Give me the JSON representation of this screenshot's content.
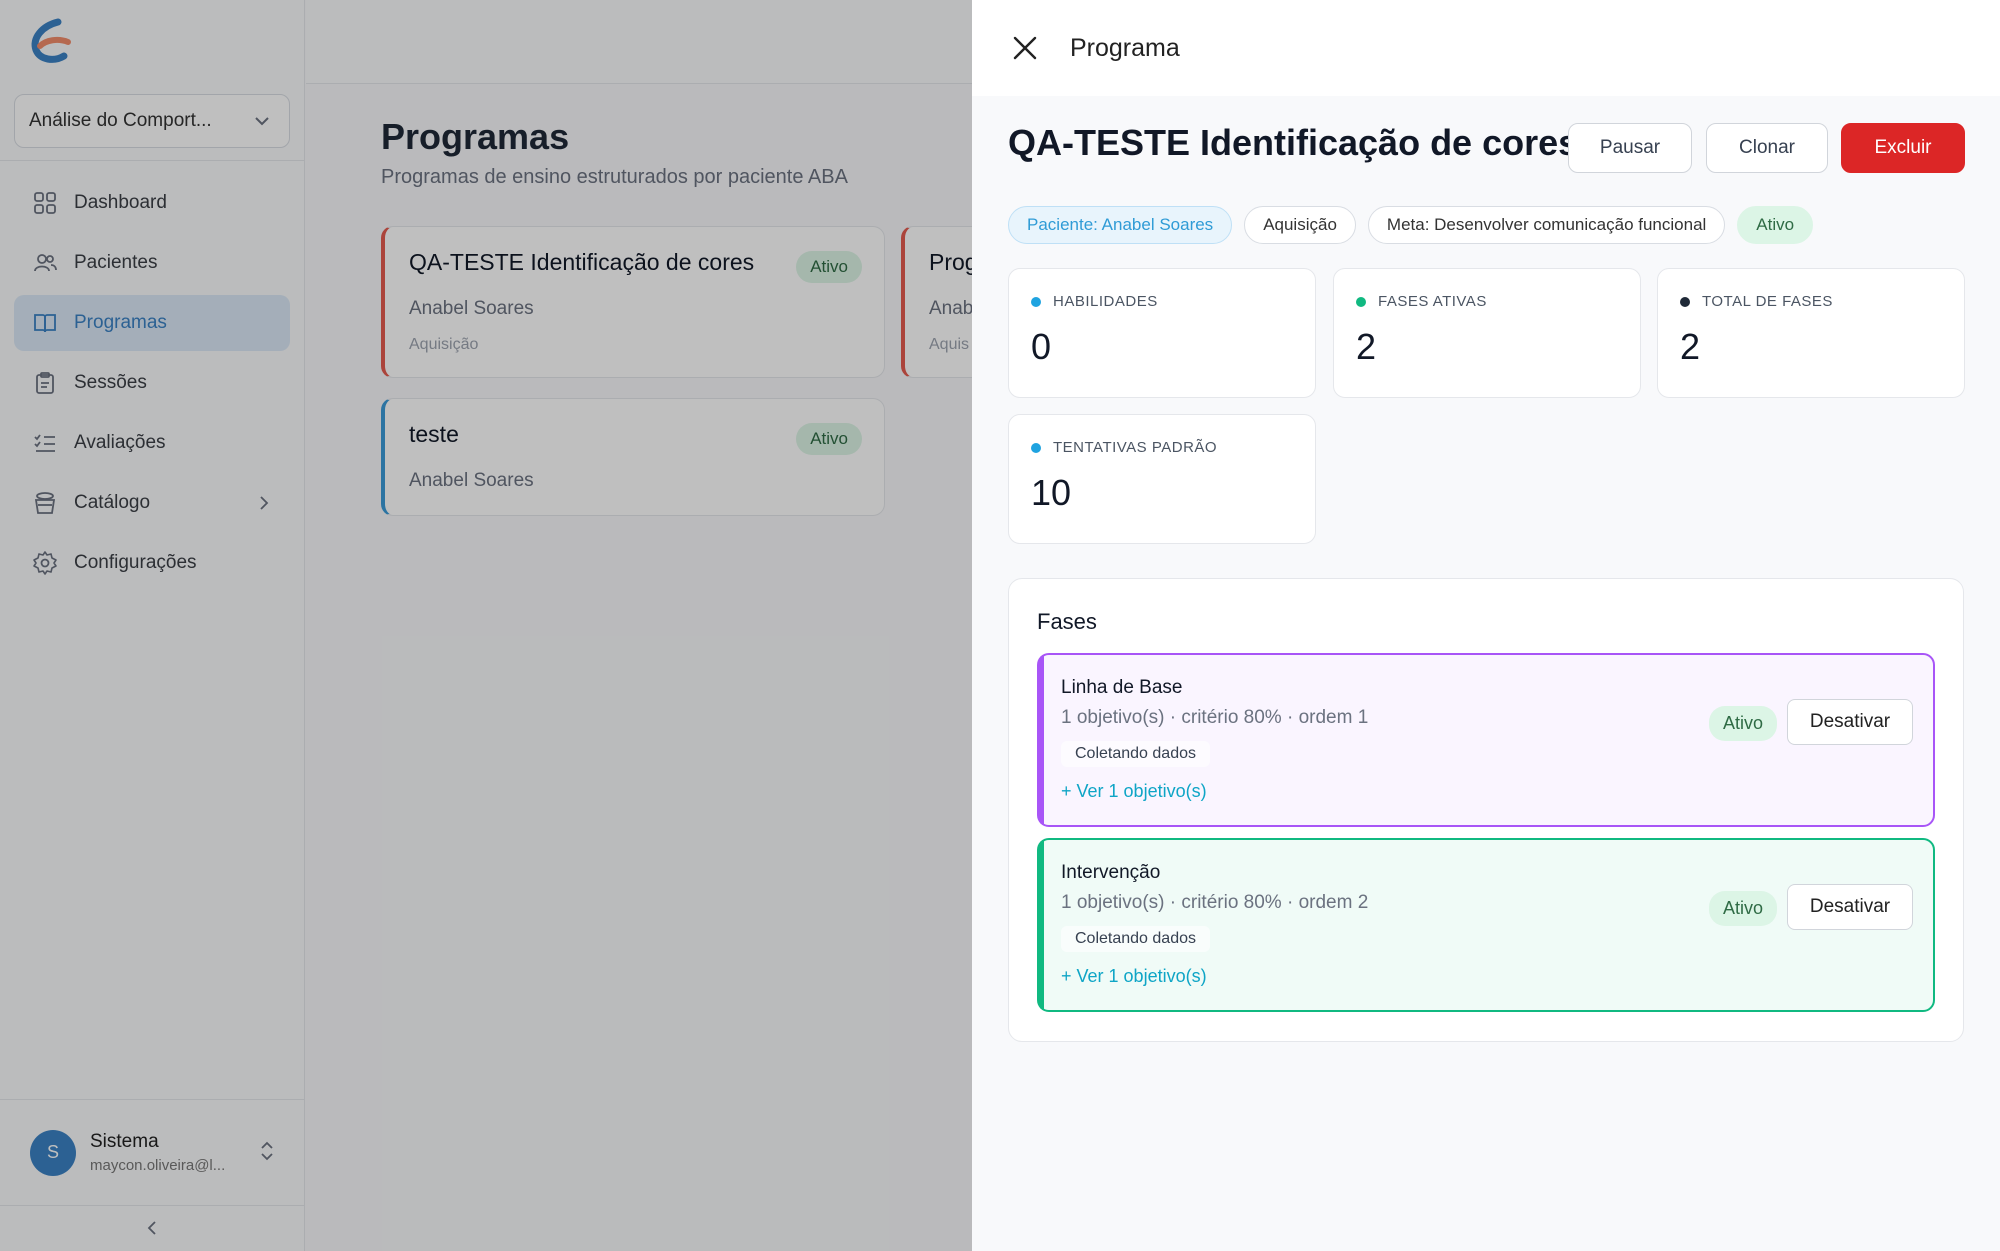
{
  "sidebar": {
    "workspace": "Análise do Comport...",
    "items": [
      {
        "label": "Dashboard"
      },
      {
        "label": "Pacientes"
      },
      {
        "label": "Programas"
      },
      {
        "label": "Sessões"
      },
      {
        "label": "Avaliações"
      },
      {
        "label": "Catálogo"
      },
      {
        "label": "Configurações"
      }
    ],
    "user": {
      "initial": "S",
      "name": "Sistema",
      "email": "maycon.oliveira@l..."
    }
  },
  "main": {
    "title": "Programas",
    "subtitle": "Programas de ensino estruturados por paciente ABA",
    "cards": [
      {
        "title": "QA-TESTE Identificação de cores",
        "patient": "Anabel Soares",
        "category": "Aquisição",
        "status": "Ativo"
      },
      {
        "title": "teste",
        "patient": "Anabel Soares",
        "status": "Ativo"
      },
      {
        "title": "Prog",
        "patient": "Anab",
        "category": "Aquis"
      }
    ]
  },
  "drawer": {
    "header_title": "Programa",
    "program_title": "QA-TESTE Identificação de cores",
    "buttons": {
      "pause": "Pausar",
      "clone": "Clonar",
      "delete": "Excluir"
    },
    "tags": {
      "patient": "Paciente: Anabel Soares",
      "category": "Aquisição",
      "goal": "Meta: Desenvolver comunicação funcional",
      "status": "Ativo"
    },
    "stats": [
      {
        "label": "HABILIDADES",
        "value": "0",
        "color": "#1fa3e0"
      },
      {
        "label": "FASES ATIVAS",
        "value": "2",
        "color": "#10b981"
      },
      {
        "label": "TOTAL DE FASES",
        "value": "2",
        "color": "#1f2937"
      },
      {
        "label": "TENTATIVAS PADRÃO",
        "value": "10",
        "color": "#1fa3e0"
      }
    ],
    "fases": {
      "title": "Fases",
      "items": [
        {
          "name": "Linha de Base",
          "meta": "1 objetivo(s) · critério 80% · ordem 1",
          "state": "Coletando dados",
          "link": "+ Ver 1 objetivo(s)",
          "badge": "Ativo",
          "action": "Desativar",
          "accent": "#a855f7",
          "bg": "#faf5ff"
        },
        {
          "name": "Intervenção",
          "meta": "1 objetivo(s) · critério 80% · ordem 2",
          "state": "Coletando dados",
          "link": "+ Ver 1 objetivo(s)",
          "badge": "Ativo",
          "action": "Desativar",
          "accent": "#10b981",
          "bg": "#f0fbf7"
        }
      ]
    }
  }
}
